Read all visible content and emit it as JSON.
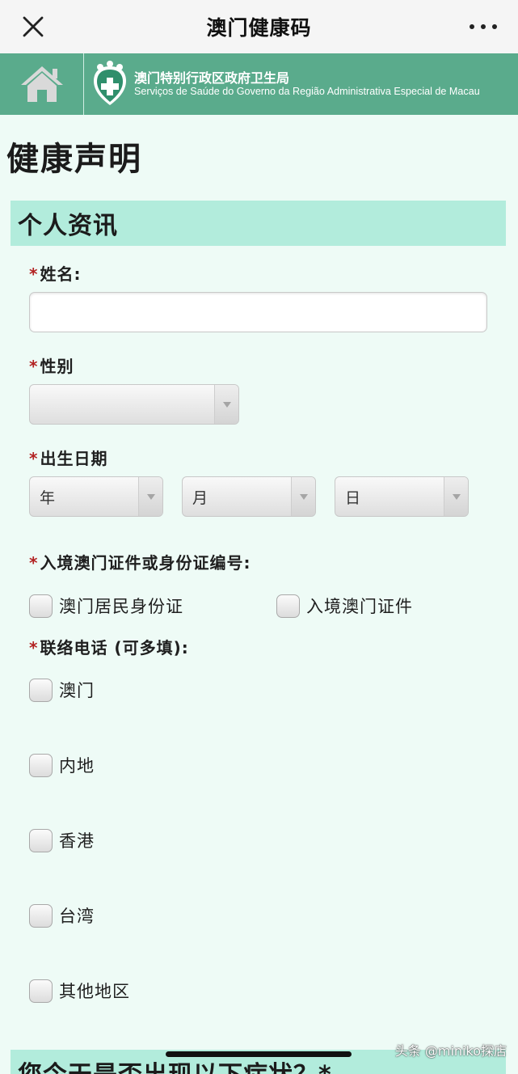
{
  "topbar": {
    "title": "澳门健康码",
    "close_icon": "close-icon",
    "more_icon": "more-icon"
  },
  "gov_header": {
    "name_zh": "澳门特别行政区政府卫生局",
    "name_pt": "Serviços de Saúde do Governo da Região Administrativa Especial de Macau",
    "home_icon": "home-icon",
    "emblem_icon": "health-bureau-emblem-icon",
    "band_color": "#5aab8c"
  },
  "page": {
    "title": "健康声明"
  },
  "section_personal": {
    "title": "个人资讯",
    "color": "#b2ecdc"
  },
  "fields": {
    "name": {
      "required": "*",
      "label": "姓名:",
      "value": "",
      "placeholder": ""
    },
    "gender": {
      "required": "*",
      "label": "性别",
      "value": ""
    },
    "birthdate": {
      "required": "*",
      "label": "出生日期",
      "year": "年",
      "month": "月",
      "day": "日"
    },
    "id_doc": {
      "required": "*",
      "label": "入境澳门证件或身份证编号:",
      "options": [
        "澳门居民身份证",
        "入境澳门证件"
      ]
    },
    "phone": {
      "required": "*",
      "label": "联络电话 (可多填):",
      "options": [
        "澳门",
        "内地",
        "香港",
        "台湾",
        "其他地区"
      ]
    }
  },
  "next_section": {
    "partial_title": "您今天是否出现以下症状？*"
  },
  "watermark": "头条 @miniko探店"
}
